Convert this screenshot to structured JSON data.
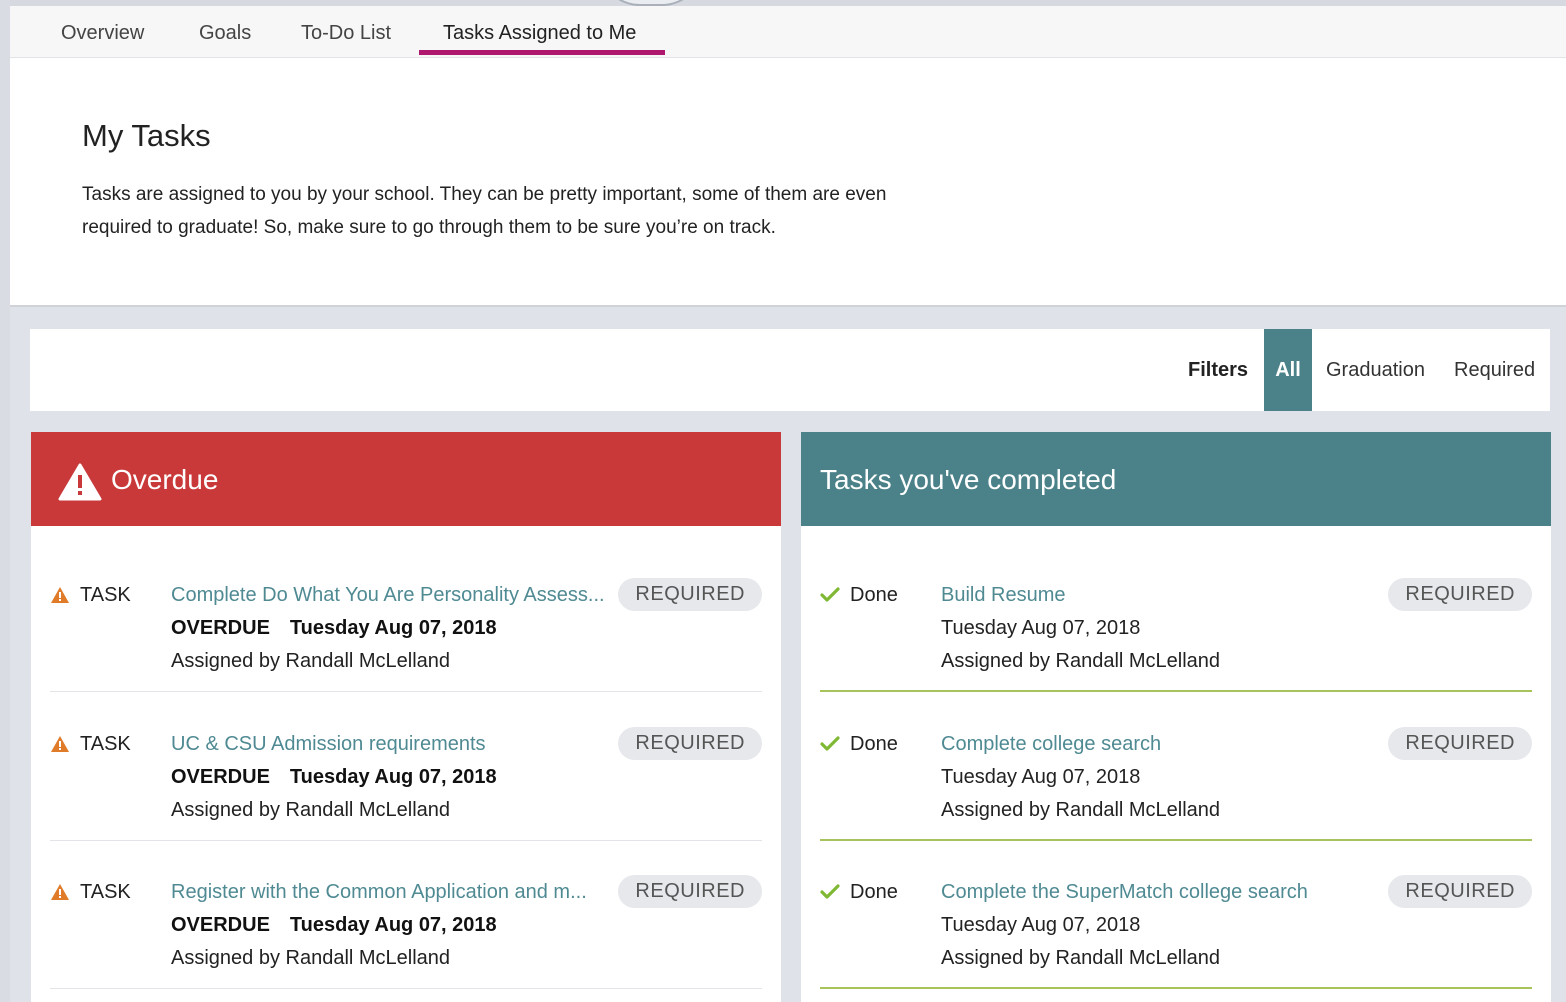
{
  "tabs": [
    {
      "label": "Overview"
    },
    {
      "label": "Goals"
    },
    {
      "label": "To-Do List"
    },
    {
      "label": "Tasks Assigned to Me"
    }
  ],
  "active_tab": "Tasks Assigned to Me",
  "header": {
    "title": "My Tasks",
    "intro_line1": "Tasks are assigned to you by your school. They can be pretty important, some of them are even",
    "intro_line2": "required to graduate! So, make sure to go through them to be sure you’re on track."
  },
  "filters": {
    "label": "Filters",
    "options": [
      "All",
      "Graduation",
      "Required"
    ],
    "selected": "All"
  },
  "overdue": {
    "title": "Overdue",
    "icon": "warning-icon",
    "accent_color": "#c9393a",
    "items": [
      {
        "kind": "TASK",
        "title": "Complete Do What You Are Personality Assess...",
        "status": "OVERDUE",
        "date": "Tuesday Aug 07, 2018",
        "assigned": "Assigned by Randall McLelland",
        "badge": "REQUIRED"
      },
      {
        "kind": "TASK",
        "title": "UC & CSU Admission requirements",
        "status": "OVERDUE",
        "date": "Tuesday Aug 07, 2018",
        "assigned": "Assigned by Randall McLelland",
        "badge": "REQUIRED"
      },
      {
        "kind": "TASK",
        "title": "Register with the Common Application and m...",
        "status": "OVERDUE",
        "date": "Tuesday Aug 07, 2018",
        "assigned": "Assigned by Randall McLelland",
        "badge": "REQUIRED"
      }
    ]
  },
  "completed": {
    "title": "Tasks you've completed",
    "accent_color": "#4b8289",
    "items": [
      {
        "kind": "Done",
        "title": "Build Resume",
        "date": "Tuesday Aug 07, 2018",
        "assigned": "Assigned by Randall McLelland",
        "badge": "REQUIRED"
      },
      {
        "kind": "Done",
        "title": "Complete college search",
        "date": "Tuesday Aug 07, 2018",
        "assigned": "Assigned by Randall McLelland",
        "badge": "REQUIRED"
      },
      {
        "kind": "Done",
        "title": "Complete the SuperMatch college search",
        "date": "Tuesday Aug 07, 2018",
        "assigned": "Assigned by Randall McLelland",
        "badge": "REQUIRED"
      }
    ]
  }
}
